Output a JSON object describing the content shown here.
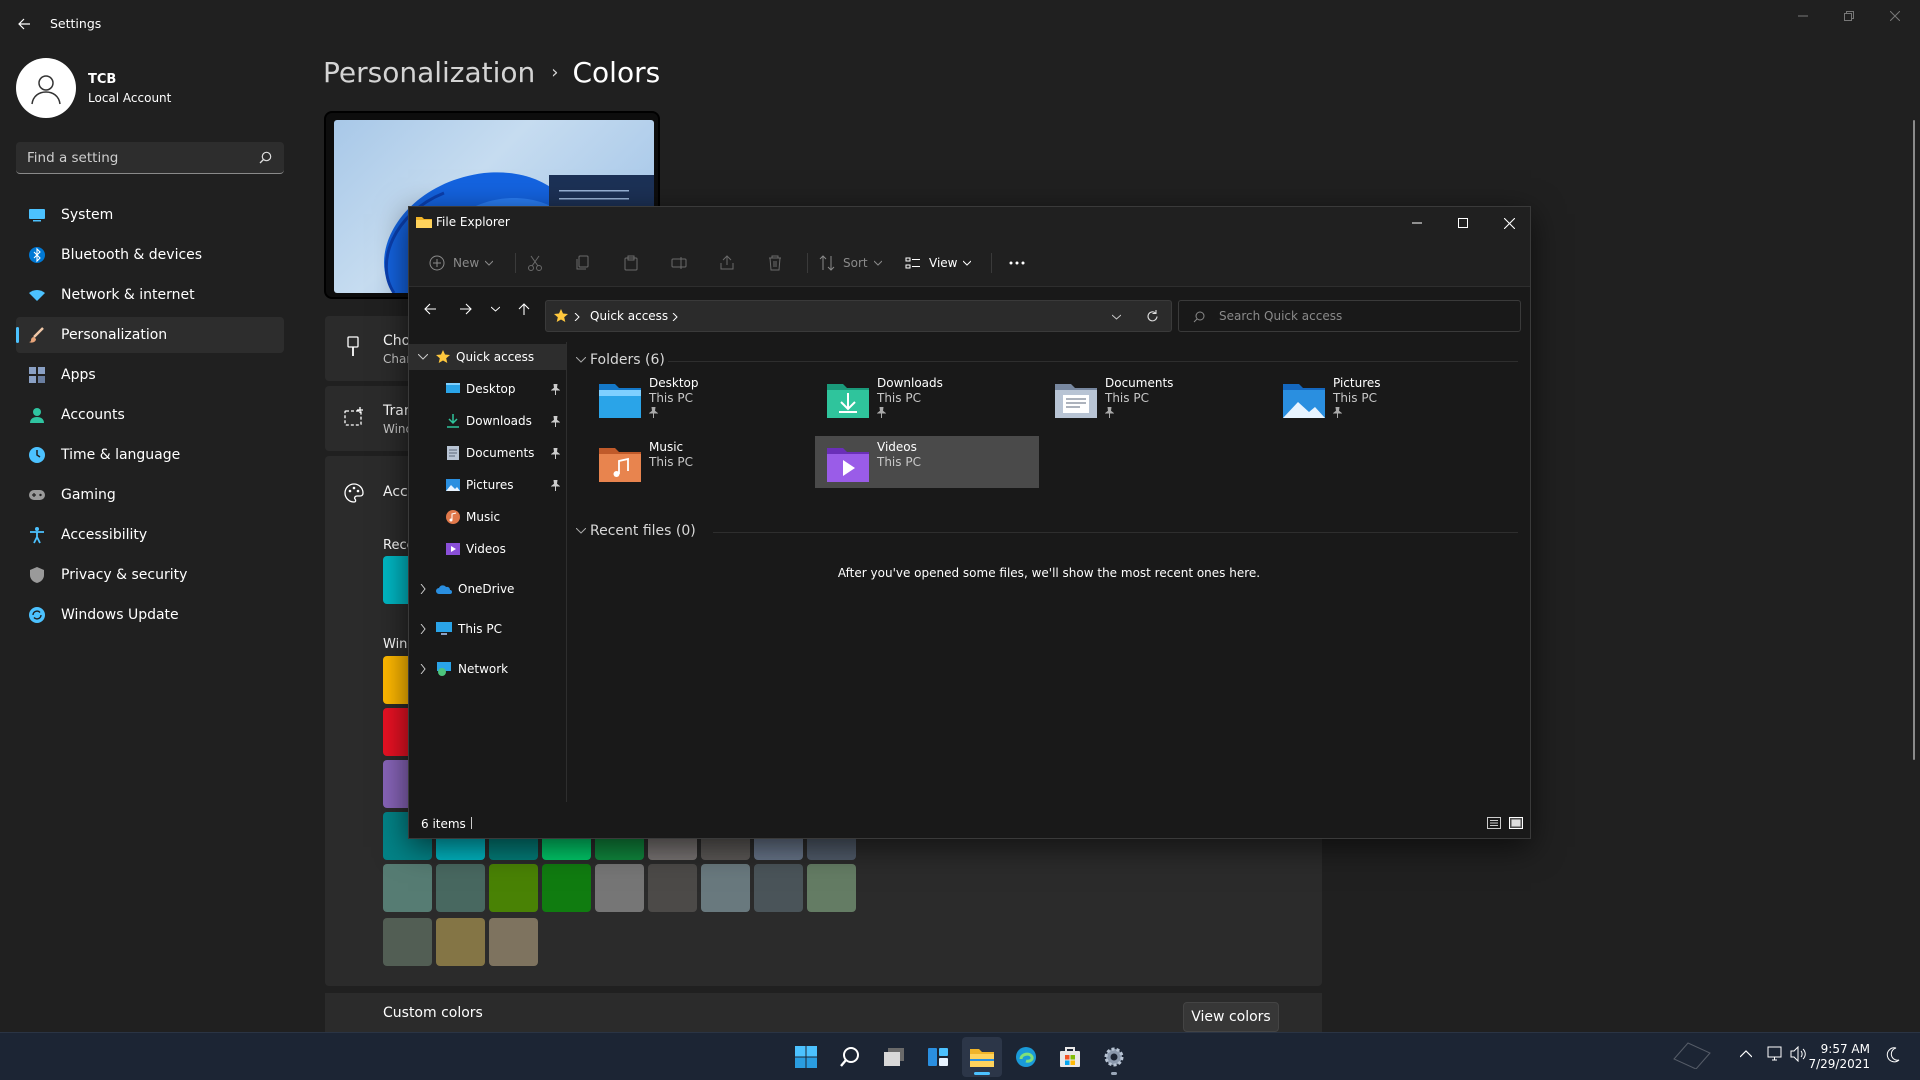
{
  "settings": {
    "title": "Settings",
    "profile": {
      "name": "TCB",
      "account": "Local Account"
    },
    "search_placeholder": "Find a setting",
    "nav": [
      {
        "label": "System",
        "icon": "system-icon",
        "color": "#4cc2ff"
      },
      {
        "label": "Bluetooth & devices",
        "icon": "bluetooth-icon",
        "color": "#0078d4"
      },
      {
        "label": "Network & internet",
        "icon": "wifi-icon",
        "color": "#4cc2ff"
      },
      {
        "label": "Personalization",
        "icon": "brush-icon",
        "color": "#e8a57a",
        "active": true
      },
      {
        "label": "Apps",
        "icon": "apps-icon",
        "color": "#8aa0c4"
      },
      {
        "label": "Accounts",
        "icon": "accounts-icon",
        "color": "#2fc4a0"
      },
      {
        "label": "Time & language",
        "icon": "time-language-icon",
        "color": "#4cc2ff"
      },
      {
        "label": "Gaming",
        "icon": "gaming-icon",
        "color": "#9a9a9a"
      },
      {
        "label": "Accessibility",
        "icon": "accessibility-icon",
        "color": "#4cc2ff"
      },
      {
        "label": "Privacy & security",
        "icon": "shield-icon",
        "color": "#9a9a9a"
      },
      {
        "label": "Windows Update",
        "icon": "update-icon",
        "color": "#4cc2ff"
      }
    ],
    "breadcrumb": {
      "parent": "Personalization",
      "sep": "›",
      "current": "Colors"
    },
    "cards": {
      "choose_title": "Cho",
      "choose_sub": "Char",
      "transparency_title": "Tran",
      "transparency_sub": "Winc",
      "accent_title": "Acc",
      "recent_label": "Rece",
      "windows_label": "Win"
    },
    "custom_colors_label": "Custom colors",
    "view_colors_button": "View colors"
  },
  "explorer": {
    "title": "File Explorer",
    "toolbar": {
      "new": "New",
      "sort": "Sort",
      "view": "View"
    },
    "address": {
      "location": "Quick access"
    },
    "search_placeholder": "Search Quick access",
    "sidebar": {
      "quick_access": "Quick access",
      "pinned": [
        "Desktop",
        "Downloads",
        "Documents",
        "Pictures"
      ],
      "others": [
        "Music",
        "Videos"
      ],
      "onedrive": "OneDrive",
      "this_pc": "This PC",
      "network": "Network"
    },
    "folders_header": "Folders (6)",
    "folders": [
      {
        "name": "Desktop",
        "location": "This PC",
        "pinned": true
      },
      {
        "name": "Downloads",
        "location": "This PC",
        "pinned": true
      },
      {
        "name": "Documents",
        "location": "This PC",
        "pinned": true
      },
      {
        "name": "Pictures",
        "location": "This PC",
        "pinned": true
      },
      {
        "name": "Music",
        "location": "This PC",
        "pinned": false
      },
      {
        "name": "Videos",
        "location": "This PC",
        "pinned": false,
        "selected": true
      }
    ],
    "recent_header": "Recent files (0)",
    "recent_empty": "After you've opened some files, we'll show the most recent ones here.",
    "status": {
      "items": "6 items"
    }
  },
  "taskbar": {
    "time": "9:57 AM",
    "date": "7/29/2021",
    "apps": [
      "start-icon",
      "search-icon",
      "task-view-icon",
      "widgets-icon",
      "file-explorer-icon",
      "edge-icon",
      "store-icon",
      "settings-icon"
    ]
  },
  "accent_swatches": {
    "rows": [
      [
        "#ffb900"
      ],
      [
        "#e81123"
      ],
      [
        "#8764b8"
      ],
      [
        "#038387",
        "#00b7c3",
        "#037e7a",
        "#00cc6a",
        "#10893e",
        "#7a7574",
        "#5d5a58",
        "#68768a",
        "#515c6b"
      ],
      [
        "#567c73",
        "#486860",
        "#498205",
        "#107c10",
        "#767676",
        "#4c4a48",
        "#69797e",
        "#4a5459",
        "#647c64"
      ],
      [
        "#525e54",
        "#847545",
        "#7e735f"
      ]
    ]
  }
}
